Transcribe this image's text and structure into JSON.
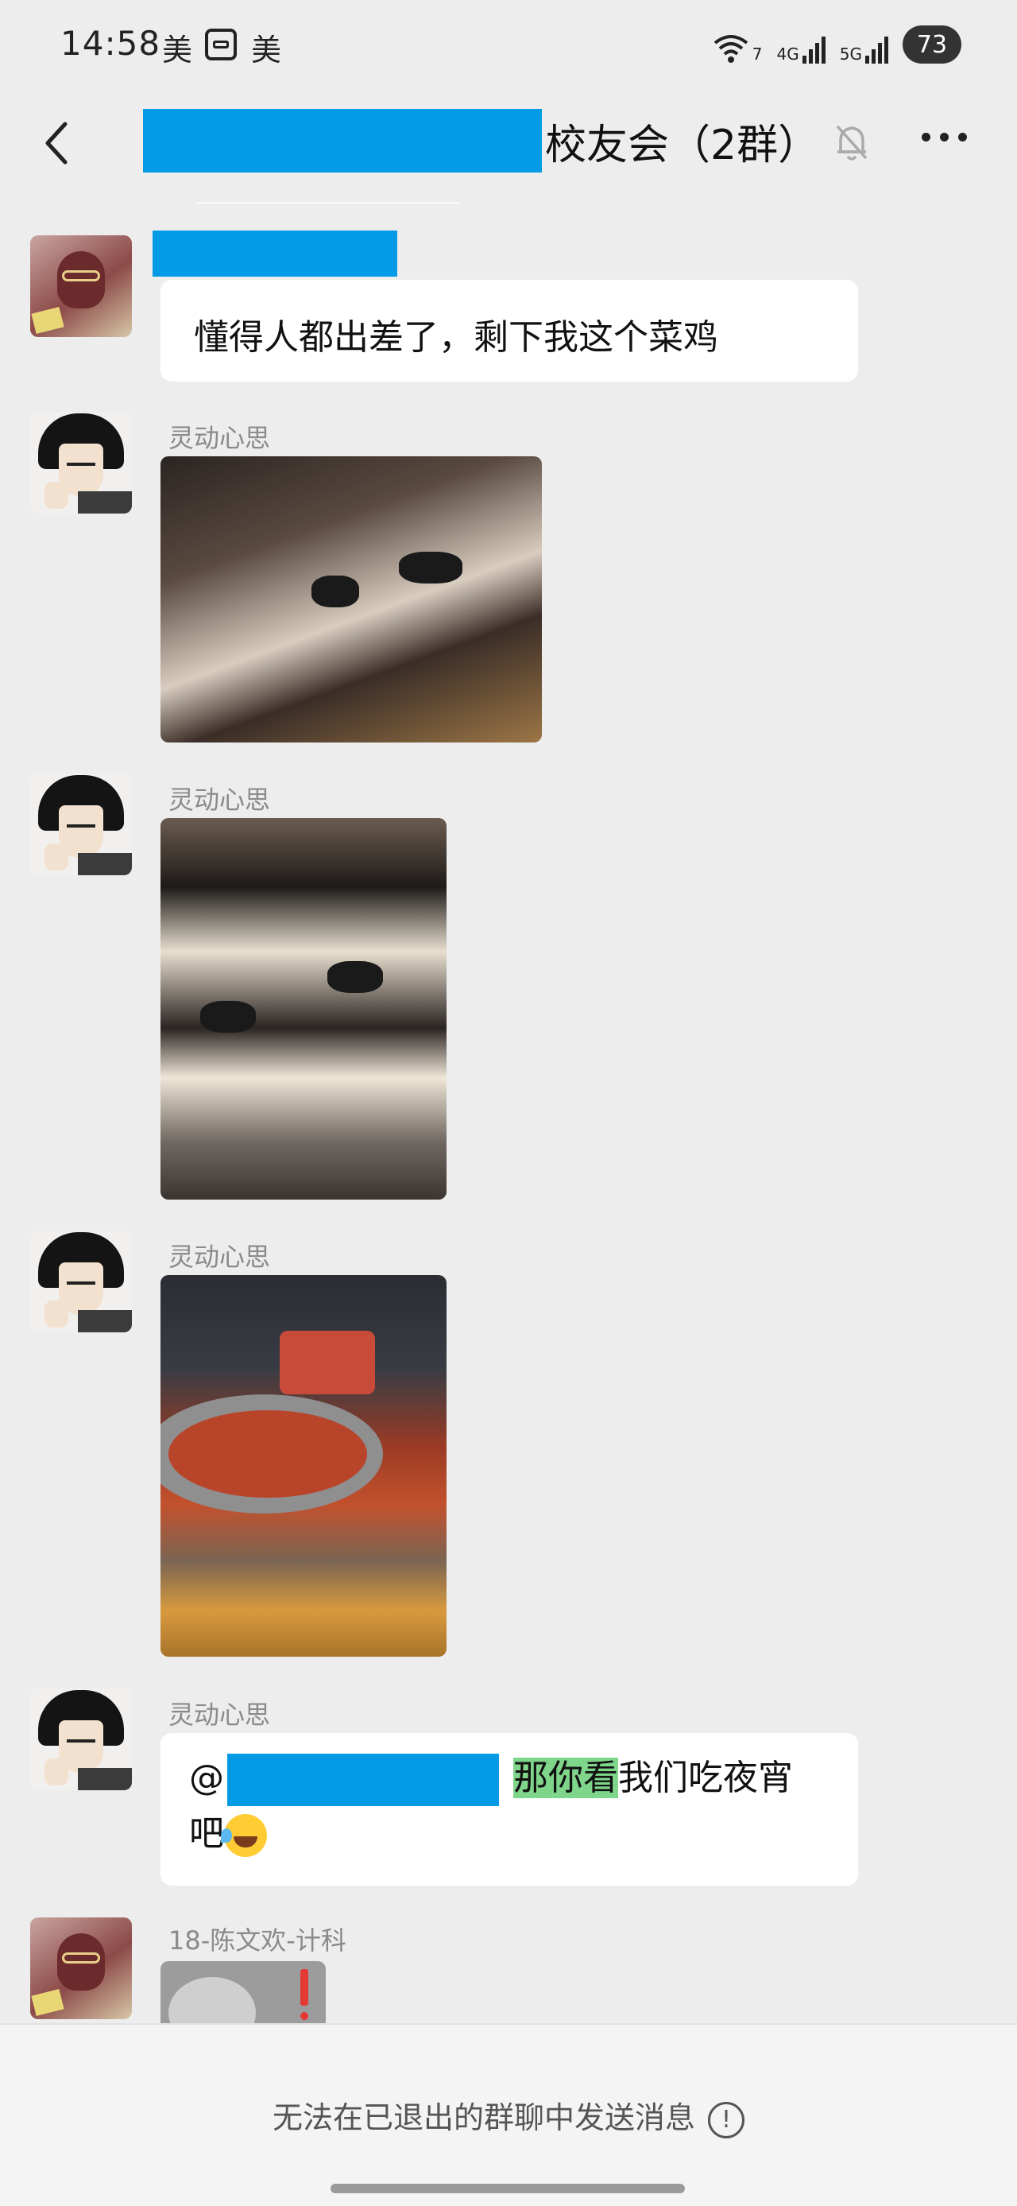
{
  "status_bar": {
    "time": "14:58",
    "app_icon_1": "美",
    "app_icon_2": "美",
    "wifi_label": "7",
    "signal_4g": "4G",
    "signal_5g": "5G",
    "battery": "73"
  },
  "header": {
    "title_suffix": "校友会（2群）",
    "back_icon": "chevron-left-icon",
    "mute_icon": "bell-off-icon",
    "more_icon": "more-dots-icon"
  },
  "messages": [
    {
      "sender": "",
      "text": "懂得人都出差了，剩下我这个菜鸡"
    },
    {
      "sender": "灵动心思",
      "type": "image"
    },
    {
      "sender": "灵动心思",
      "type": "image"
    },
    {
      "sender": "灵动心思",
      "type": "image"
    },
    {
      "sender": "灵动心思",
      "mention_prefix": "@",
      "highlight": "那你看",
      "text_rest": "我们吃夜宵",
      "text_line2": "吧"
    },
    {
      "sender": "18-陈文欢-计科",
      "type": "image"
    }
  ],
  "footer": {
    "notice": "无法在已退出的群聊中发送消息",
    "info_icon_glyph": "!"
  },
  "colors": {
    "redaction": "#039be5",
    "highlight": "#7fd68b",
    "background": "#ededed"
  }
}
